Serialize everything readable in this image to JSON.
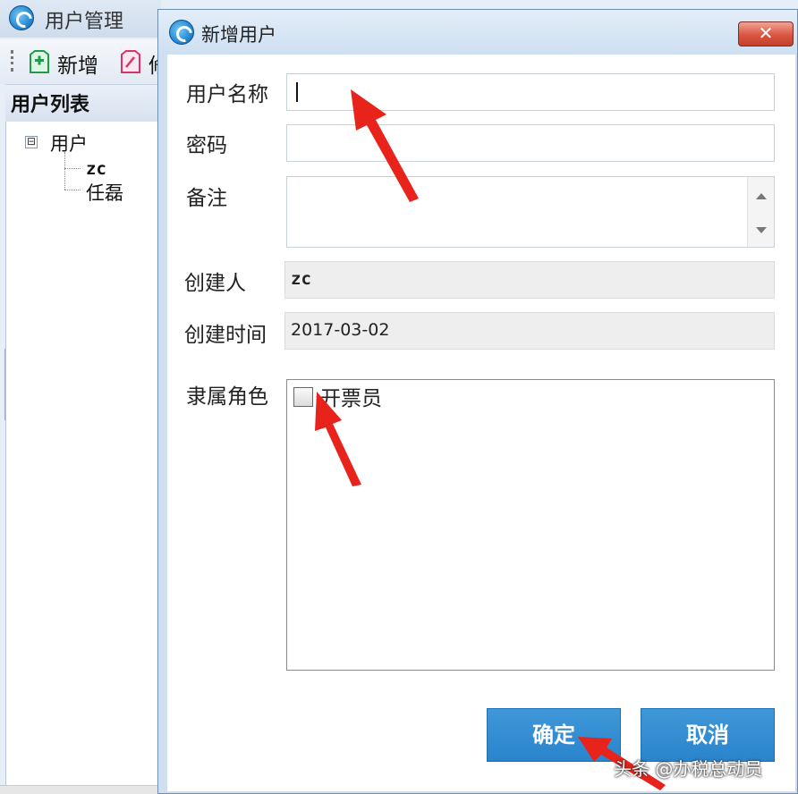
{
  "background_window": {
    "title": "用户管理",
    "toolbar": {
      "add_label": "新增",
      "edit_label_partial": "修"
    },
    "panel_title": "用户列表",
    "tree": {
      "toggle": "⊟",
      "root": "用户",
      "children": [
        "zc",
        "任磊"
      ]
    }
  },
  "dialog": {
    "title": "新增用户",
    "close_label": "✕",
    "fields": {
      "username": {
        "label": "用户名称",
        "value": ""
      },
      "password": {
        "label": "密码",
        "value": ""
      },
      "remark": {
        "label": "备注",
        "value": ""
      },
      "creator": {
        "label": "创建人",
        "value": "zc"
      },
      "created_time": {
        "label": "创建时间",
        "value": "2017-03-02"
      },
      "roles": {
        "label": "隶属角色",
        "options": [
          {
            "label": "开票员",
            "checked": false
          }
        ]
      }
    },
    "buttons": {
      "confirm": "确定",
      "cancel": "取消"
    }
  },
  "overlay": {
    "watermark": "头条 @办税总动员",
    "arrow_color": "#e8231b"
  }
}
